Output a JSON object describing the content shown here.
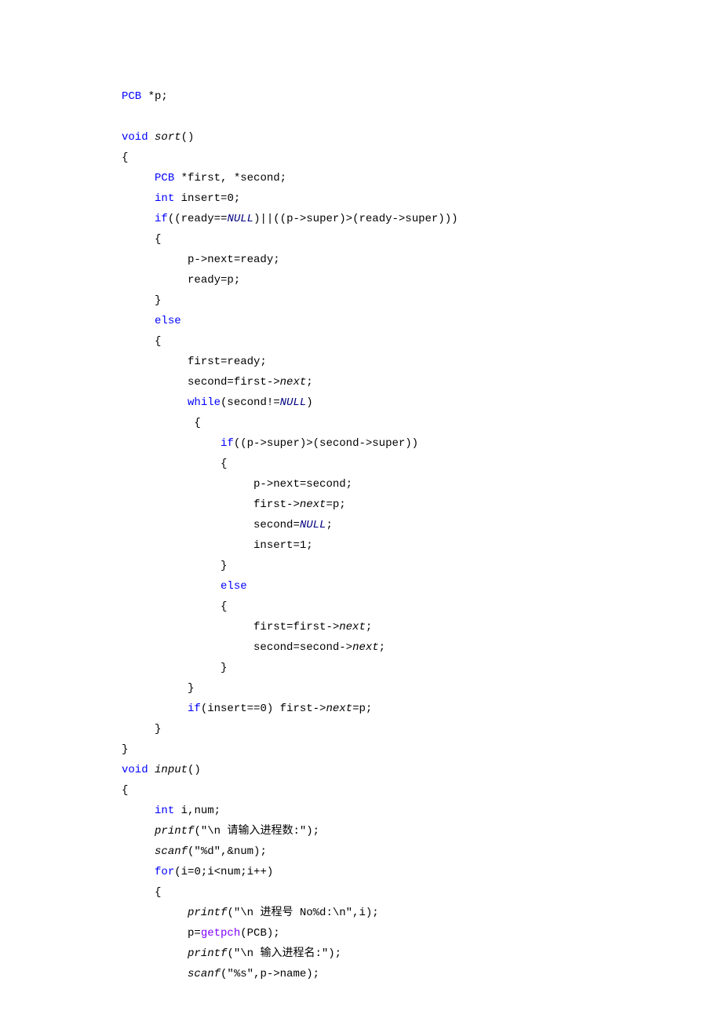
{
  "lines": [
    {
      "indent": 0,
      "tokens": [
        {
          "t": "PCB",
          "c": "type"
        },
        {
          "t": " *p;"
        }
      ]
    },
    {
      "blank": true
    },
    {
      "indent": 0,
      "tokens": [
        {
          "t": "void",
          "c": "kw"
        },
        {
          "t": " "
        },
        {
          "t": "sort",
          "c": "fn"
        },
        {
          "t": "()"
        }
      ]
    },
    {
      "indent": 0,
      "tokens": [
        {
          "t": "{"
        }
      ]
    },
    {
      "indent": 1,
      "tokens": [
        {
          "t": "PCB",
          "c": "type"
        },
        {
          "t": " *first, *second;"
        }
      ]
    },
    {
      "indent": 1,
      "tokens": [
        {
          "t": "int",
          "c": "kw"
        },
        {
          "t": " insert=0;"
        }
      ]
    },
    {
      "indent": 1,
      "tokens": [
        {
          "t": "if",
          "c": "kw"
        },
        {
          "t": "((ready=="
        },
        {
          "t": "NULL",
          "c": "nullc"
        },
        {
          "t": ")||((p->super)>(ready->super)))"
        }
      ]
    },
    {
      "indent": 1,
      "tokens": [
        {
          "t": "{"
        }
      ]
    },
    {
      "indent": 2,
      "tokens": [
        {
          "t": "p->next=ready;"
        }
      ]
    },
    {
      "indent": 2,
      "tokens": [
        {
          "t": "ready=p;"
        }
      ]
    },
    {
      "indent": 1,
      "tokens": [
        {
          "t": "}"
        }
      ]
    },
    {
      "indent": 1,
      "tokens": [
        {
          "t": "else",
          "c": "kw"
        }
      ]
    },
    {
      "indent": 1,
      "tokens": [
        {
          "t": "{"
        }
      ]
    },
    {
      "indent": 2,
      "tokens": [
        {
          "t": "first=ready;"
        }
      ]
    },
    {
      "indent": 2,
      "tokens": [
        {
          "t": "second=first->"
        },
        {
          "t": "next",
          "c": "mbr"
        },
        {
          "t": ";"
        }
      ]
    },
    {
      "indent": 2,
      "tokens": [
        {
          "t": "while",
          "c": "kw"
        },
        {
          "t": "(second!="
        },
        {
          "t": "NULL",
          "c": "nullc"
        },
        {
          "t": ")"
        }
      ]
    },
    {
      "indent": 2,
      "tokens": [
        {
          "t": " {"
        }
      ]
    },
    {
      "indent": 3,
      "tokens": [
        {
          "t": "if",
          "c": "kw"
        },
        {
          "t": "((p->super)>(second->super))"
        }
      ]
    },
    {
      "indent": 3,
      "tokens": [
        {
          "t": "{"
        }
      ]
    },
    {
      "indent": 4,
      "tokens": [
        {
          "t": "p->next=second;"
        }
      ]
    },
    {
      "indent": 4,
      "tokens": [
        {
          "t": "first->"
        },
        {
          "t": "next",
          "c": "mbr"
        },
        {
          "t": "=p;"
        }
      ]
    },
    {
      "indent": 4,
      "tokens": [
        {
          "t": "second="
        },
        {
          "t": "NULL",
          "c": "nullc"
        },
        {
          "t": ";"
        }
      ]
    },
    {
      "indent": 4,
      "tokens": [
        {
          "t": "insert=1;"
        }
      ]
    },
    {
      "indent": 3,
      "tokens": [
        {
          "t": "}"
        }
      ]
    },
    {
      "indent": 3,
      "tokens": [
        {
          "t": "else",
          "c": "kw"
        }
      ]
    },
    {
      "indent": 3,
      "tokens": [
        {
          "t": "{"
        }
      ]
    },
    {
      "indent": 4,
      "tokens": [
        {
          "t": "first=first->"
        },
        {
          "t": "next",
          "c": "mbr"
        },
        {
          "t": ";"
        }
      ]
    },
    {
      "indent": 4,
      "tokens": [
        {
          "t": "second=second->"
        },
        {
          "t": "next",
          "c": "mbr"
        },
        {
          "t": ";"
        }
      ]
    },
    {
      "indent": 3,
      "tokens": [
        {
          "t": "}"
        }
      ]
    },
    {
      "indent": 2,
      "tokens": [
        {
          "t": "}"
        }
      ]
    },
    {
      "indent": 2,
      "tokens": [
        {
          "t": "if",
          "c": "kw"
        },
        {
          "t": "(insert==0) first->"
        },
        {
          "t": "next",
          "c": "mbr"
        },
        {
          "t": "=p;"
        }
      ]
    },
    {
      "indent": 1,
      "tokens": [
        {
          "t": "}"
        }
      ]
    },
    {
      "indent": 0,
      "tokens": [
        {
          "t": "}"
        }
      ]
    },
    {
      "indent": 0,
      "tokens": [
        {
          "t": "void",
          "c": "kw"
        },
        {
          "t": " "
        },
        {
          "t": "input",
          "c": "fn"
        },
        {
          "t": "()"
        }
      ]
    },
    {
      "indent": 0,
      "tokens": [
        {
          "t": "{"
        }
      ]
    },
    {
      "indent": 1,
      "tokens": [
        {
          "t": "int",
          "c": "kw"
        },
        {
          "t": " i,num;"
        }
      ]
    },
    {
      "indent": 1,
      "tokens": [
        {
          "t": "printf",
          "c": "fn"
        },
        {
          "t": "(\"\\n 请输入进程数:\");"
        }
      ]
    },
    {
      "indent": 1,
      "tokens": [
        {
          "t": "scanf",
          "c": "fn"
        },
        {
          "t": "(\"%d\",&num);"
        }
      ]
    },
    {
      "indent": 1,
      "tokens": [
        {
          "t": "for",
          "c": "kw"
        },
        {
          "t": "(i=0;i<num;i++)"
        }
      ]
    },
    {
      "indent": 1,
      "tokens": [
        {
          "t": "{"
        }
      ]
    },
    {
      "indent": 2,
      "tokens": [
        {
          "t": "printf",
          "c": "fn"
        },
        {
          "t": "(\"\\n 进程号 No%d:\\n\",i);"
        }
      ]
    },
    {
      "indent": 2,
      "tokens": [
        {
          "t": "p="
        },
        {
          "t": "getpch",
          "c": "call"
        },
        {
          "t": "(PCB);"
        }
      ]
    },
    {
      "indent": 2,
      "tokens": [
        {
          "t": "printf",
          "c": "fn"
        },
        {
          "t": "(\"\\n 输入进程名:\");"
        }
      ]
    },
    {
      "indent": 2,
      "tokens": [
        {
          "t": "scanf",
          "c": "fn"
        },
        {
          "t": "(\"%s\",p->name);"
        }
      ]
    }
  ],
  "indentUnit": "     "
}
